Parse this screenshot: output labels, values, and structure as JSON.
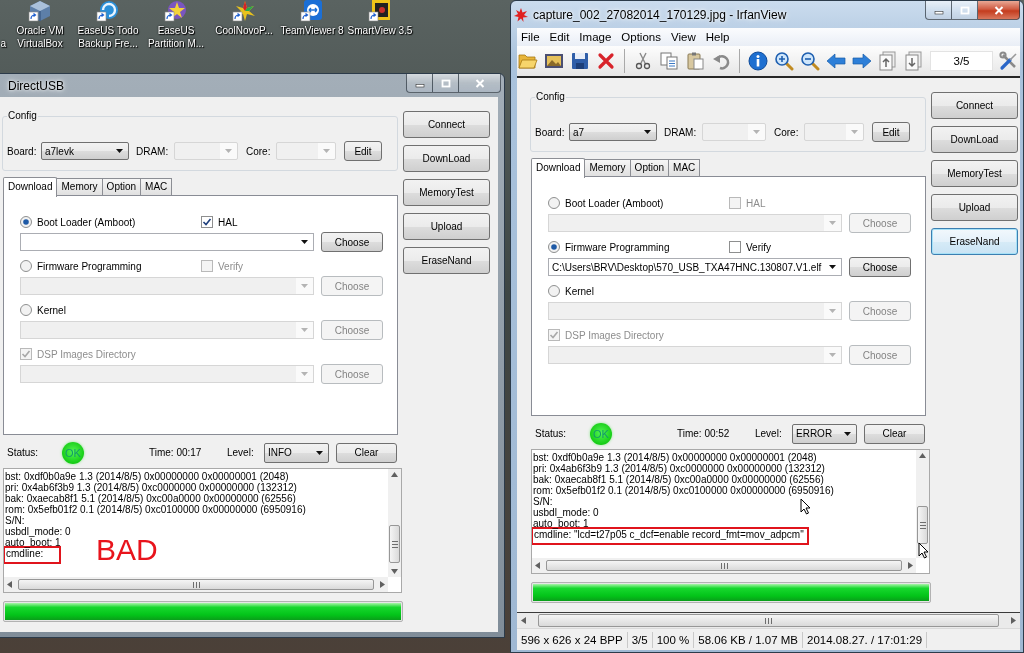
{
  "desktop_icons": [
    {
      "kind": "clipped",
      "lines": [
        "a"
      ]
    },
    {
      "kind": "cube",
      "lines": [
        "Oracle VM",
        "VirtualBox"
      ]
    },
    {
      "kind": "swirl",
      "lines": [
        "EaseUS Todo",
        "Backup Fre..."
      ]
    },
    {
      "kind": "star-disc",
      "lines": [
        "EaseUS",
        "Partition M..."
      ]
    },
    {
      "kind": "burst",
      "lines": [
        "CoolNovoP..."
      ]
    },
    {
      "kind": "tile",
      "lines": [
        "TeamViewer 8"
      ]
    },
    {
      "kind": "screen",
      "lines": [
        "SmartView 3.5"
      ]
    }
  ],
  "windows": [
    {
      "kind": "directusb",
      "title": "DirectUSB",
      "active": false,
      "content": {
        "config": {
          "title": "Config",
          "fields": [
            {
              "label": "Board:",
              "value": "a7levk",
              "disabled": false
            },
            {
              "label": "DRAM:",
              "disabled": true
            },
            {
              "label": "Core:",
              "disabled": true
            }
          ],
          "edit_button": "Edit"
        },
        "side_buttons": [
          {
            "label": "Connect",
            "focused": false
          },
          {
            "label": "DownLoad",
            "focused": false
          },
          {
            "label": "MemoryTest",
            "focused": false
          },
          {
            "label": "Upload",
            "focused": false
          },
          {
            "label": "EraseNand",
            "focused": false
          }
        ],
        "tabs": [
          {
            "label": "Download",
            "selected": true
          },
          {
            "label": "Memory",
            "selected": false
          },
          {
            "label": "Option",
            "selected": false
          },
          {
            "label": "MAC",
            "selected": false
          }
        ],
        "download_rows": [
          {
            "kind": "radio",
            "label": "Boot Loader (Amboot)",
            "selected": true,
            "option": {
              "label": "HAL",
              "checked": true,
              "disabled": false
            },
            "path": {
              "disabled": false
            },
            "choose": {
              "label": "Choose",
              "disabled": false
            }
          },
          {
            "kind": "radio",
            "label": "Firmware Programming",
            "selected": false,
            "option": {
              "label": "Verify",
              "checked": false,
              "disabled": true
            },
            "path": {
              "disabled": true
            },
            "choose": {
              "label": "Choose",
              "disabled": true
            }
          },
          {
            "kind": "radio",
            "label": "Kernel",
            "selected": false,
            "path": {
              "disabled": true
            },
            "choose": {
              "label": "Choose",
              "disabled": true
            }
          },
          {
            "kind": "checkbox",
            "label": "DSP Images Directory",
            "checked": true,
            "disabled": true,
            "path": {
              "disabled": true
            },
            "choose": {
              "label": "Choose",
              "disabled": true
            }
          }
        ],
        "status": {
          "label": "Status:",
          "light": "OK",
          "time": "Time: 00:17",
          "level_label": "Level:",
          "level_value": "INFO",
          "clear_button": "Clear"
        },
        "log": {
          "lines": [
            {
              "text": "bst: 0xdf0b0a9e 1.3 (2014/8/5) 0x00000000 0x00000001 (2048)",
              "boxed": false
            },
            {
              "text": "pri: 0x4ab6f3b9 1.3 (2014/8/5) 0xc0000000 0x00000000 (132312)",
              "boxed": false
            },
            {
              "text": "bak: 0xaecab8f1 5.1 (2014/8/5) 0xc00a0000 0x00000000 (62556)",
              "boxed": false
            },
            {
              "text": "rom: 0x5efb01f2 0.1 (2014/8/5) 0xc0100000 0x00000000 (6950916)",
              "boxed": false
            },
            {
              "text": "S/N:",
              "boxed": false
            },
            {
              "text": "usbdl_mode: 0",
              "boxed": false
            },
            {
              "text": "auto_boot: 1",
              "boxed": false
            },
            {
              "text": "cmdline:",
              "boxed": true
            }
          ],
          "annotation": "BAD"
        },
        "progress": {
          "level": 1
        }
      }
    },
    {
      "kind": "irfanview",
      "title": "capture_002_27082014_170129.jpg - IrfanView",
      "active": true,
      "menu": [
        "File",
        "Edit",
        "Image",
        "Options",
        "View",
        "Help"
      ],
      "page_field": "3/5",
      "content": {
        "config": {
          "title": "Config",
          "fields": [
            {
              "label": "Board:",
              "value": "a7",
              "disabled": false
            },
            {
              "label": "DRAM:",
              "disabled": true
            },
            {
              "label": "Core:",
              "disabled": true
            }
          ],
          "edit_button": "Edit"
        },
        "side_buttons": [
          {
            "label": "Connect",
            "focused": false
          },
          {
            "label": "DownLoad",
            "focused": false
          },
          {
            "label": "MemoryTest",
            "focused": false
          },
          {
            "label": "Upload",
            "focused": false
          },
          {
            "label": "EraseNand",
            "focused": true
          }
        ],
        "tabs": [
          {
            "label": "Download",
            "selected": true
          },
          {
            "label": "Memory",
            "selected": false
          },
          {
            "label": "Option",
            "selected": false
          },
          {
            "label": "MAC",
            "selected": false
          }
        ],
        "download_rows": [
          {
            "kind": "radio",
            "label": "Boot Loader (Amboot)",
            "selected": false,
            "option": {
              "label": "HAL",
              "checked": false,
              "disabled": true
            },
            "path": {
              "disabled": true
            },
            "choose": {
              "label": "Choose",
              "disabled": true
            }
          },
          {
            "kind": "radio",
            "label": "Firmware Programming",
            "selected": true,
            "option": {
              "label": "Verify",
              "checked": false,
              "disabled": false
            },
            "path": {
              "value": "C:\\Users\\BRV\\Desktop\\570_USB_TXA47HNC.130807.V1.elf",
              "disabled": false
            },
            "choose": {
              "label": "Choose",
              "disabled": false
            }
          },
          {
            "kind": "radio",
            "label": "Kernel",
            "selected": false,
            "path": {
              "disabled": true
            },
            "choose": {
              "label": "Choose",
              "disabled": true
            }
          },
          {
            "kind": "checkbox",
            "label": "DSP Images Directory",
            "checked": true,
            "disabled": true,
            "path": {
              "disabled": true
            },
            "choose": {
              "label": "Choose",
              "disabled": true
            }
          }
        ],
        "status": {
          "label": "Status:",
          "light": "OK",
          "time": "Time: 00:52",
          "level_label": "Level:",
          "level_value": "ERROR",
          "clear_button": "Clear"
        },
        "log": {
          "lines": [
            {
              "text": "bst: 0xdf0b0a9e 1.3 (2014/8/5) 0x00000000 0x00000001 (2048)",
              "boxed": false
            },
            {
              "text": "pri: 0x4ab6f3b9 1.3 (2014/8/5) 0xc0000000 0x00000000 (132312)",
              "boxed": false
            },
            {
              "text": "bak: 0xaecab8f1 5.1 (2014/8/5) 0xc00a0000 0x00000000 (62556)",
              "boxed": false
            },
            {
              "text": "rom: 0x5efb01f2 0.1 (2014/8/5) 0xc0100000 0x00000000 (6950916)",
              "boxed": false
            },
            {
              "text": "S/N:",
              "boxed": false
            },
            {
              "text": "usbdl_mode: 0",
              "boxed": false
            },
            {
              "text": "auto_boot: 1",
              "boxed": false
            },
            {
              "text": "cmdline: \"lcd=t27p05 c_dcf=enable record_fmt=mov_adpcm\"",
              "boxed": true
            }
          ]
        },
        "progress": {
          "level": 1
        }
      },
      "status_bar": [
        "596 x 626 x 24 BPP",
        "3/5",
        "100 %",
        "58.06 KB / 1.07 MB",
        "2014.08.27. / 17:01:29"
      ]
    }
  ]
}
